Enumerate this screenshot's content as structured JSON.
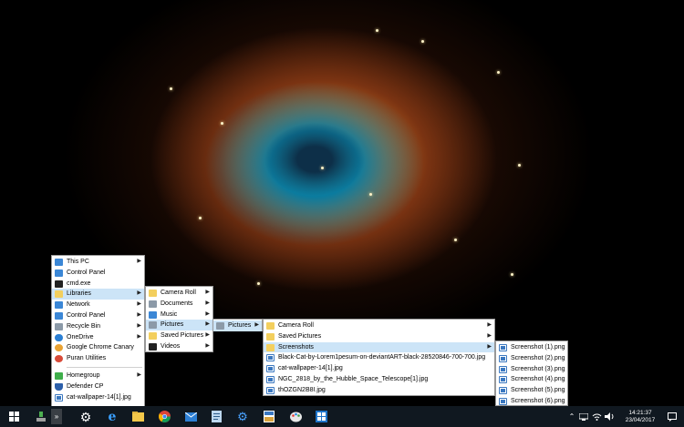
{
  "taskbar": {
    "clock_time": "14:21:37",
    "clock_date": "23/04/2017"
  },
  "menu_main": [
    {
      "label": "This PC",
      "has_submenu": true,
      "icon": "computer-icon"
    },
    {
      "label": "Control Panel",
      "has_submenu": false,
      "icon": "control-panel-icon"
    },
    {
      "label": "cmd.exe",
      "has_submenu": false,
      "icon": "cmd-icon"
    },
    {
      "label": "Libraries",
      "has_submenu": true,
      "icon": "libraries-icon"
    },
    {
      "label": "Network",
      "has_submenu": true,
      "icon": "network-icon"
    },
    {
      "label": "Control Panel",
      "has_submenu": true,
      "icon": "control-panel-icon"
    },
    {
      "label": "Recycle Bin",
      "has_submenu": true,
      "icon": "recycle-bin-icon"
    },
    {
      "label": "OneDrive",
      "has_submenu": true,
      "icon": "onedrive-icon"
    },
    {
      "label": "Google Chrome Canary",
      "has_submenu": false,
      "icon": "chrome-canary-icon"
    },
    {
      "label": "Puran Utilities",
      "has_submenu": false,
      "icon": "puran-icon"
    },
    {
      "label": "Homegroup",
      "has_submenu": true,
      "icon": "homegroup-icon"
    },
    {
      "label": "Defender CP",
      "has_submenu": false,
      "icon": "defender-icon"
    },
    {
      "label": "cat-wallpaper-14[1].jpg",
      "has_submenu": false,
      "icon": "image-file-icon"
    }
  ],
  "menu_libraries": [
    {
      "label": "Camera Roll",
      "has_submenu": true,
      "icon": "camera-roll-icon"
    },
    {
      "label": "Documents",
      "has_submenu": true,
      "icon": "documents-icon"
    },
    {
      "label": "Music",
      "has_submenu": true,
      "icon": "music-icon"
    },
    {
      "label": "Pictures",
      "has_submenu": true,
      "icon": "pictures-icon"
    },
    {
      "label": "Saved Pictures",
      "has_submenu": true,
      "icon": "saved-pictures-icon"
    },
    {
      "label": "Videos",
      "has_submenu": true,
      "icon": "videos-icon"
    }
  ],
  "menu_pictures_lib": [
    {
      "label": "Pictures",
      "has_submenu": true,
      "icon": "pictures-icon"
    }
  ],
  "menu_pictures": [
    {
      "label": "Camera Roll",
      "has_submenu": true,
      "icon": "folder-icon"
    },
    {
      "label": "Saved Pictures",
      "has_submenu": true,
      "icon": "folder-icon"
    },
    {
      "label": "Screenshots",
      "has_submenu": true,
      "icon": "folder-icon"
    },
    {
      "label": "Black-Cat-by-Lorem1pesum-on-deviantART-black-28520846-700-700.jpg",
      "has_submenu": false,
      "icon": "image-file-icon"
    },
    {
      "label": "cat-wallpaper-14[1].jpg",
      "has_submenu": false,
      "icon": "image-file-icon"
    },
    {
      "label": "NGC_2818_by_the_Hubble_Space_Telescope[1].jpg",
      "has_submenu": false,
      "icon": "image-file-icon"
    },
    {
      "label": "thOZGN2B8I.jpg",
      "has_submenu": false,
      "icon": "image-file-icon"
    }
  ],
  "menu_screenshots": [
    {
      "label": "Screenshot (1).png",
      "icon": "image-file-icon"
    },
    {
      "label": "Screenshot (2).png",
      "icon": "image-file-icon"
    },
    {
      "label": "Screenshot (3).png",
      "icon": "image-file-icon"
    },
    {
      "label": "Screenshot (4).png",
      "icon": "image-file-icon"
    },
    {
      "label": "Screenshot (5).png",
      "icon": "image-file-icon"
    },
    {
      "label": "Screenshot (6).png",
      "icon": "image-file-icon"
    }
  ]
}
